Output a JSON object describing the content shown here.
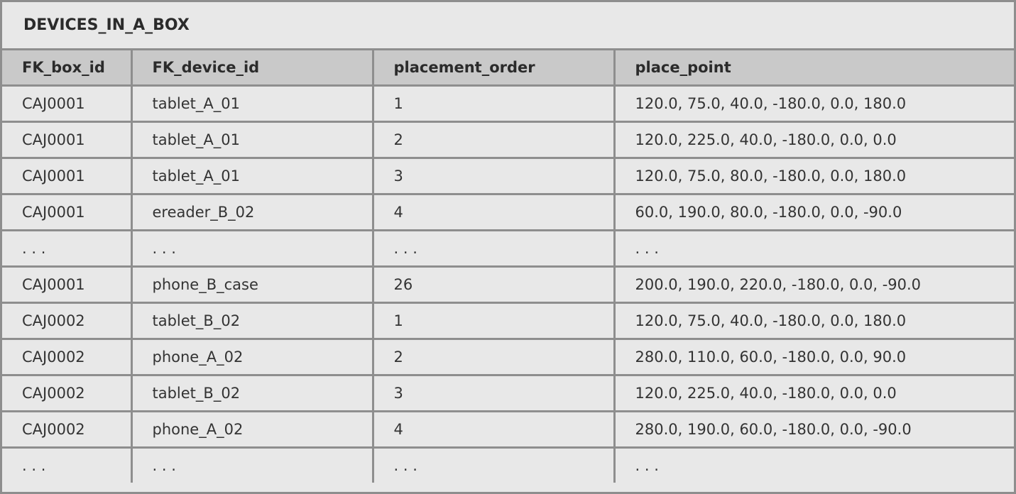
{
  "table_title": "DEVICES_IN_A_BOX",
  "columns": [
    "FK_box_id",
    "FK_device_id",
    "placement_order",
    "place_point"
  ],
  "rows": [
    [
      "CAJ0001",
      "tablet_A_01",
      "1",
      "120.0, 75.0, 40.0, -180.0, 0.0, 180.0"
    ],
    [
      "CAJ0001",
      "tablet_A_01",
      "2",
      "120.0, 225.0, 40.0, -180.0, 0.0, 0.0"
    ],
    [
      "CAJ0001",
      "tablet_A_01",
      "3",
      "120.0, 75.0, 80.0, -180.0, 0.0, 180.0"
    ],
    [
      "CAJ0001",
      "ereader_B_02",
      "4",
      "60.0, 190.0, 80.0, -180.0, 0.0, -90.0"
    ],
    [
      ". . .",
      ". . .",
      ". . .",
      ". . ."
    ],
    [
      "CAJ0001",
      "phone_B_case",
      "26",
      "200.0, 190.0, 220.0, -180.0, 0.0, -90.0"
    ],
    [
      "CAJ0002",
      "tablet_B_02",
      "1",
      "120.0, 75.0, 40.0, -180.0, 0.0, 180.0"
    ],
    [
      "CAJ0002",
      "phone_A_02",
      "2",
      "280.0, 110.0, 60.0, -180.0, 0.0, 90.0"
    ],
    [
      "CAJ0002",
      "tablet_B_02",
      "3",
      "120.0, 225.0, 40.0, -180.0, 0.0, 0.0"
    ],
    [
      "CAJ0002",
      "phone_A_02",
      "4",
      "280.0, 190.0, 60.0, -180.0, 0.0, -90.0"
    ],
    [
      ". . .",
      ". . .",
      ". . .",
      ". . ."
    ]
  ]
}
